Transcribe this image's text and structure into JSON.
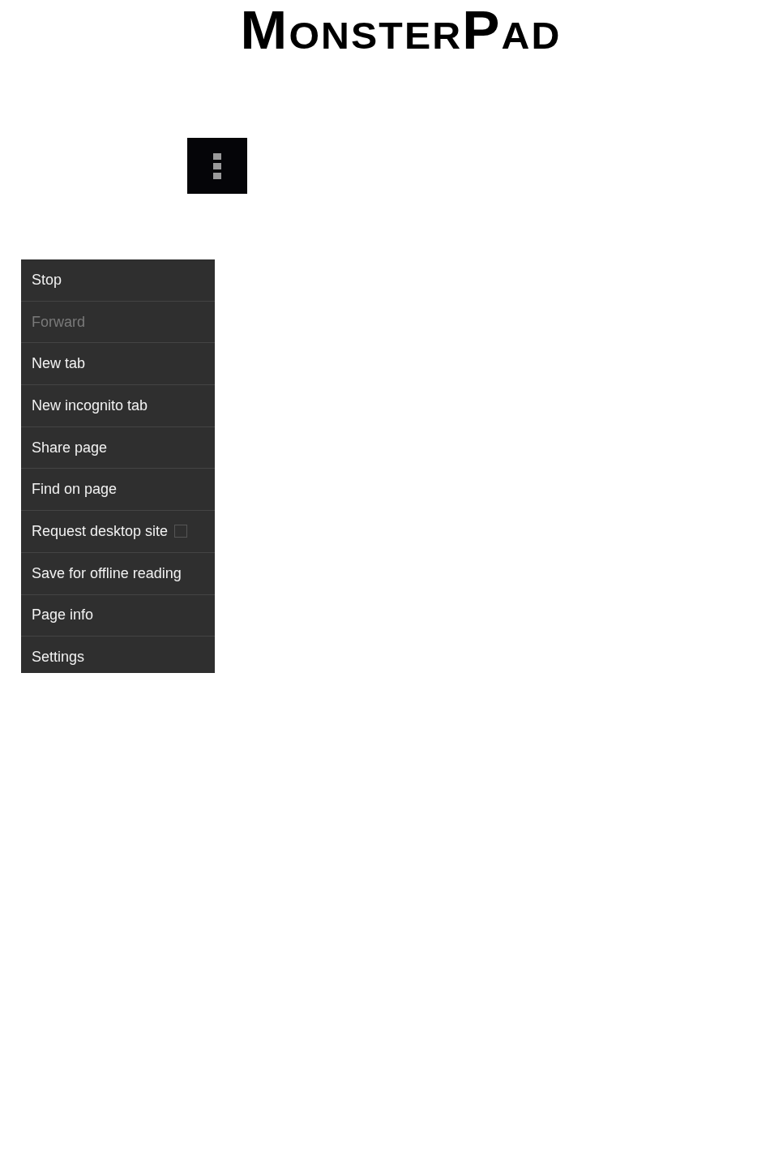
{
  "logo": {
    "text": "MonsterPad"
  },
  "menu": {
    "items": [
      {
        "kind": "action",
        "label": "Stop",
        "disabled": false
      },
      {
        "kind": "action",
        "label": "Forward",
        "disabled": true
      },
      {
        "kind": "action",
        "label": "New tab",
        "disabled": false
      },
      {
        "kind": "action",
        "label": "New incognito tab",
        "disabled": false
      },
      {
        "kind": "action",
        "label": "Share page",
        "disabled": false
      },
      {
        "kind": "action",
        "label": "Find on page",
        "disabled": false
      },
      {
        "kind": "checkbox",
        "label": "Request desktop site",
        "disabled": false,
        "checked": false
      },
      {
        "kind": "action",
        "label": "Save for offline reading",
        "disabled": false
      },
      {
        "kind": "action",
        "label": "Page info",
        "disabled": false
      },
      {
        "kind": "action",
        "label": "Settings",
        "disabled": false
      }
    ]
  }
}
